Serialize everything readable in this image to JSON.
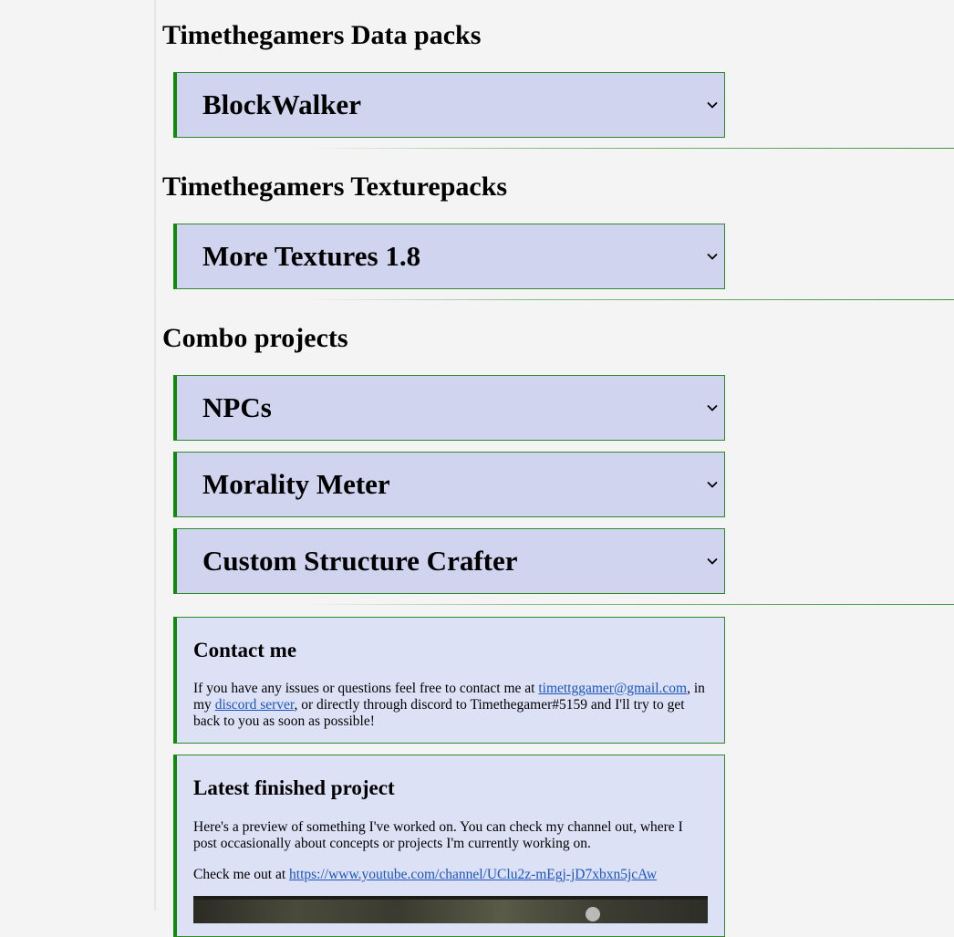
{
  "sections": {
    "datapacks": {
      "heading": "Timethegamers Data packs",
      "items": [
        {
          "label": "BlockWalker"
        }
      ]
    },
    "texturepacks": {
      "heading": "Timethegamers Texturepacks",
      "items": [
        {
          "label": "More Textures 1.8"
        }
      ]
    },
    "combo": {
      "heading": "Combo projects",
      "items": [
        {
          "label": "NPCs"
        },
        {
          "label": "Morality Meter"
        },
        {
          "label": "Custom Structure Crafter"
        }
      ]
    }
  },
  "contact": {
    "title": "Contact me",
    "text_1": "If you have any issues or questions feel free to contact me at ",
    "email": "timettggamer@gmail.com",
    "text_2": ", in my ",
    "discord_link": "discord server",
    "text_3": ", or directly through discord to Timethegamer#5159 and I'll try to get back to you as soon as possible!"
  },
  "latest": {
    "title": "Latest finished project",
    "description": "Here's a preview of something I've worked on. You can check my channel out, where I post occasionally about concepts or projects I'm currently working on.",
    "checkout_text": "Check me out at ",
    "channel_url": "https://www.youtube.com/channel/UClu2z-mEgj-jD7xbxn5jcAw"
  },
  "icons": {
    "dropdown": "chevron-down-icon"
  },
  "colors": {
    "accent_green": "#0f8a0f",
    "dropdown_bg": "#d0d4ee",
    "card_bg": "#dde1f5",
    "link": "#1a55c0"
  }
}
